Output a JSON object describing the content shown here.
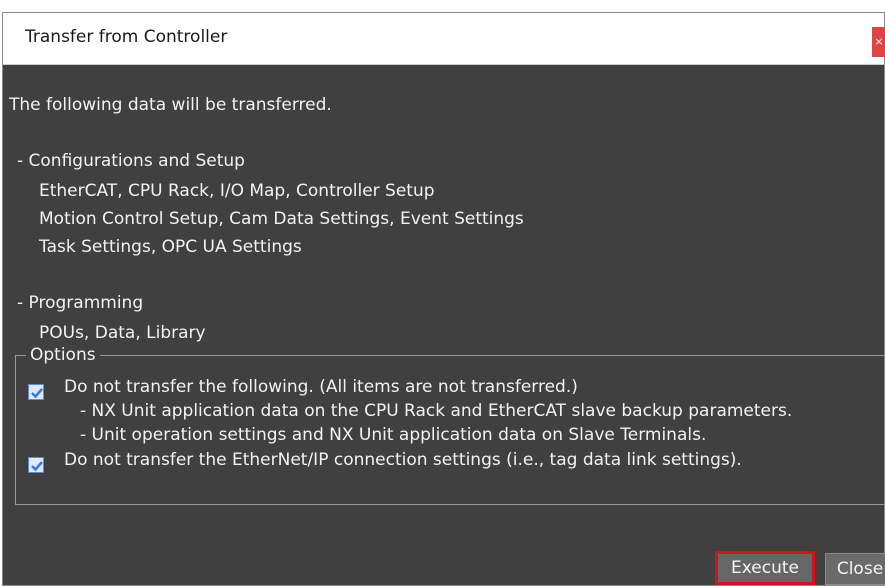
{
  "dialog": {
    "title": "Transfer from Controller",
    "close_glyph": "×",
    "intro": "The following data will be transferred.",
    "sections": [
      {
        "heading": "- Configurations and Setup",
        "lines": [
          "EtherCAT, CPU Rack, I/O Map, Controller Setup",
          "Motion Control Setup, Cam Data Settings, Event Settings",
          "Task Settings, OPC UA Settings"
        ]
      },
      {
        "heading": "- Programming",
        "lines": [
          "POUs, Data, Library"
        ]
      }
    ],
    "options": {
      "legend": "Options",
      "items": [
        {
          "checked": true,
          "label": "Do not transfer the following. (All items are not transferred.)",
          "sub_lines": [
            "- NX Unit application data on the CPU Rack and EtherCAT slave backup parameters.",
            "- Unit operation settings and NX Unit application data on Slave Terminals."
          ]
        },
        {
          "checked": true,
          "label": "Do not transfer the EtherNet/IP connection settings (i.e., tag data link settings).",
          "sub_lines": []
        }
      ]
    },
    "buttons": {
      "execute": "Execute",
      "close": "Close"
    },
    "colors": {
      "background": "#404040",
      "titlebar": "#ffffff",
      "accent_highlight": "#d0141b",
      "checkbox_check": "#3b78d8"
    }
  }
}
